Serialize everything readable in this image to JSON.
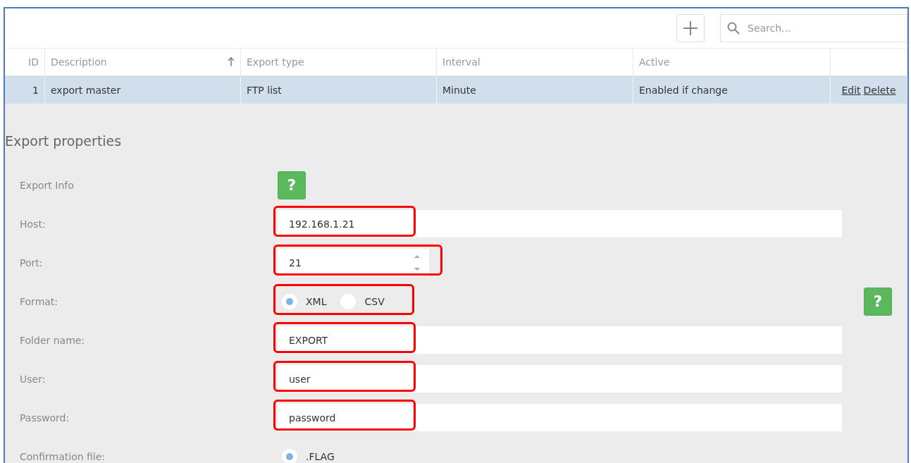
{
  "toolbar": {
    "search": {
      "placeholder": "Search..."
    }
  },
  "table": {
    "columns": [
      {
        "label": "ID",
        "sorted": false
      },
      {
        "label": "Description",
        "sorted": true
      },
      {
        "label": "Export type",
        "sorted": false
      },
      {
        "label": "Interval",
        "sorted": false
      },
      {
        "label": "Active",
        "sorted": false
      }
    ],
    "rows": [
      {
        "cells": [
          "1",
          "export master",
          "FTP list",
          "Minute",
          "Enabled if change"
        ],
        "selected": true,
        "actions": [
          "Edit",
          "Delete"
        ]
      }
    ]
  },
  "form": {
    "title": "Export properties",
    "side_help": {
      "label": "?"
    },
    "fields": [
      {
        "kind": "help",
        "label": "Export Info",
        "button": "?"
      },
      {
        "kind": "text",
        "label": "Host:",
        "value": "192.168.1.21",
        "highlighted": true
      },
      {
        "kind": "number",
        "label": "Port:",
        "value": "21",
        "highlighted": true
      },
      {
        "kind": "radio",
        "label": "Format:",
        "highlighted": true,
        "options": [
          {
            "label": "XML",
            "selected": true
          },
          {
            "label": "CSV",
            "selected": false
          }
        ]
      },
      {
        "kind": "text",
        "label": "Folder name:",
        "value": "EXPORT",
        "highlighted": true
      },
      {
        "kind": "text",
        "label": "User:",
        "value": "user",
        "highlighted": true
      },
      {
        "kind": "text",
        "label": "Password:",
        "value": "password",
        "highlighted": true
      },
      {
        "kind": "radio",
        "label": "Confirmation file:",
        "highlighted": false,
        "options": [
          {
            "label": ".FLAG",
            "selected": true
          }
        ]
      }
    ]
  }
}
